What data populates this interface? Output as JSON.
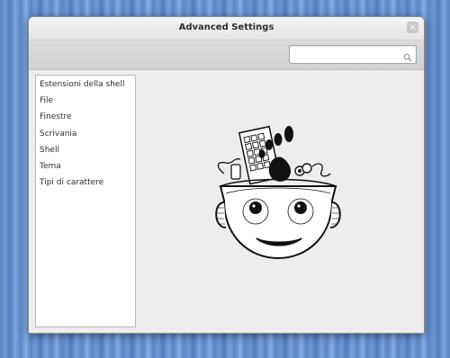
{
  "window": {
    "title": "Advanced Settings",
    "close_glyph": "×"
  },
  "search": {
    "value": "",
    "placeholder": "",
    "icon": "search-icon"
  },
  "sidebar": {
    "items": [
      {
        "label": "Estensioni della shell"
      },
      {
        "label": "File"
      },
      {
        "label": "Finestre"
      },
      {
        "label": "Scrivania"
      },
      {
        "label": "Shell"
      },
      {
        "label": "Tema"
      },
      {
        "label": "Tipi di carattere"
      }
    ]
  },
  "illustration": {
    "icon": "gnome-tweak-tool-mascot"
  },
  "colors": {
    "desktop": "#5b86c6",
    "window_bg": "#ededed",
    "accent": "#8ea8c8"
  }
}
